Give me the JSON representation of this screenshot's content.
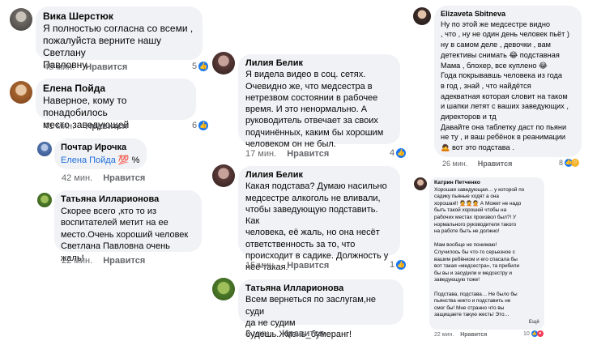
{
  "comments": [
    {
      "author": "Вика Шерстюк",
      "text": "Я полностью согласна со всеми ,\nпожалуйста верните нашу Светлану\nПавловну.",
      "time": "45 мин.",
      "like": "Нравится",
      "reactions": "5"
    },
    {
      "author": "Елена Пойда",
      "text": "Наверное, кому то понадобилось\nместо заведующей",
      "time": "41 мин.",
      "like": "Нравится",
      "reactions": "6"
    },
    {
      "author": "Почтар Ирочка",
      "mention": "Елена Пойда",
      "suffix": "%",
      "emoji": "💯",
      "time": "42 мин.",
      "like": "Нравится"
    },
    {
      "author": "Татьяна Илларионова",
      "text": "Скорее всего ,кто то из\nвоспитателей метит на ее\nместо.Очень хороший человек\nСветлана Павловна очень жаль!",
      "time": "22 мин.",
      "like": "Нравится"
    },
    {
      "author": "Лилия Белик",
      "text": "Я видела видео в соц. сетях.\nОчевидно же, что медсестра в\nнетрезвом состоянии в рабочее\nвремя. И это ненормально. А\nруководитель отвечает  за своих\nподчинённых, каким бы хорошим\nчеловеком он не был.",
      "time": "17 мин.",
      "like": "Нравится",
      "reactions": "4"
    },
    {
      "author": "Лилия Белик",
      "text": "Какая подстава? Думаю насильно\nмедсестре алкоголь не вливали,\nчтобы заведующую подставить. Как\nчеловека, её жаль, но она несёт\nответственность за то, что\nпроисходит в садике. Должность у\nнеё такая.",
      "time": "15 мин.",
      "like": "Нравится",
      "reactions": "1"
    },
    {
      "author": "Татьяна Илларионова",
      "text": "Всем вернеться по заслугам,не суди\nда не судим\nбудешь.Жизнь_бумеранг!",
      "time": "2 мин.",
      "like": "Нравится"
    },
    {
      "author": "Elizaveta Sbitneva",
      "text": "Ну по этой же медсестре видно\n, что , ну не один день человек пьёт )\nну в самом деле , девочки , вам\nдетективы снимать 😂 подставная\nМама , блохер, все куплено 😂\nГода покрывавшь человека из года\nв год , знай , что найдётся\nадекватная которая словит на таком\nи шапки летят с ваших заведующих ,\nдиректоров и тд\nДавайте она таблетку даст по пьяни\nне ту , и ваш ребёнок в реанимации\n🙇 вот это подстава .",
      "time": "26 мин.",
      "like": "Нравится",
      "reactions": "8"
    },
    {
      "author": "Катрин Петченко",
      "text": "Хорошая заведующая… у которой по\nсадику пьяные ходят а она\nхорошая!! 🤦🤦🤦 А Может не надо\nбыть такой хорошей чтобы на\nрабочих местах произвол был?! У\nнормального руководителя такого\nна работе быть не должно!\n\nМам вообще не понимаю!\nСлучилось бы что-то  серьезное с\nвашим ребёнком и его спасала бы\nвот такая «медсестра», та прибили\nбы вы и засудили и медсестру и\nзаведующую тоже!\n\nПодстава, подстава… Не было бы\nпьянства никто и подставить не\nсмог бы! Мне странно что вы\nзащищаете такую жесть! Это…",
      "more": "Ещё",
      "time": "22 мин.",
      "like": "Нравится",
      "reactions": "10"
    }
  ]
}
